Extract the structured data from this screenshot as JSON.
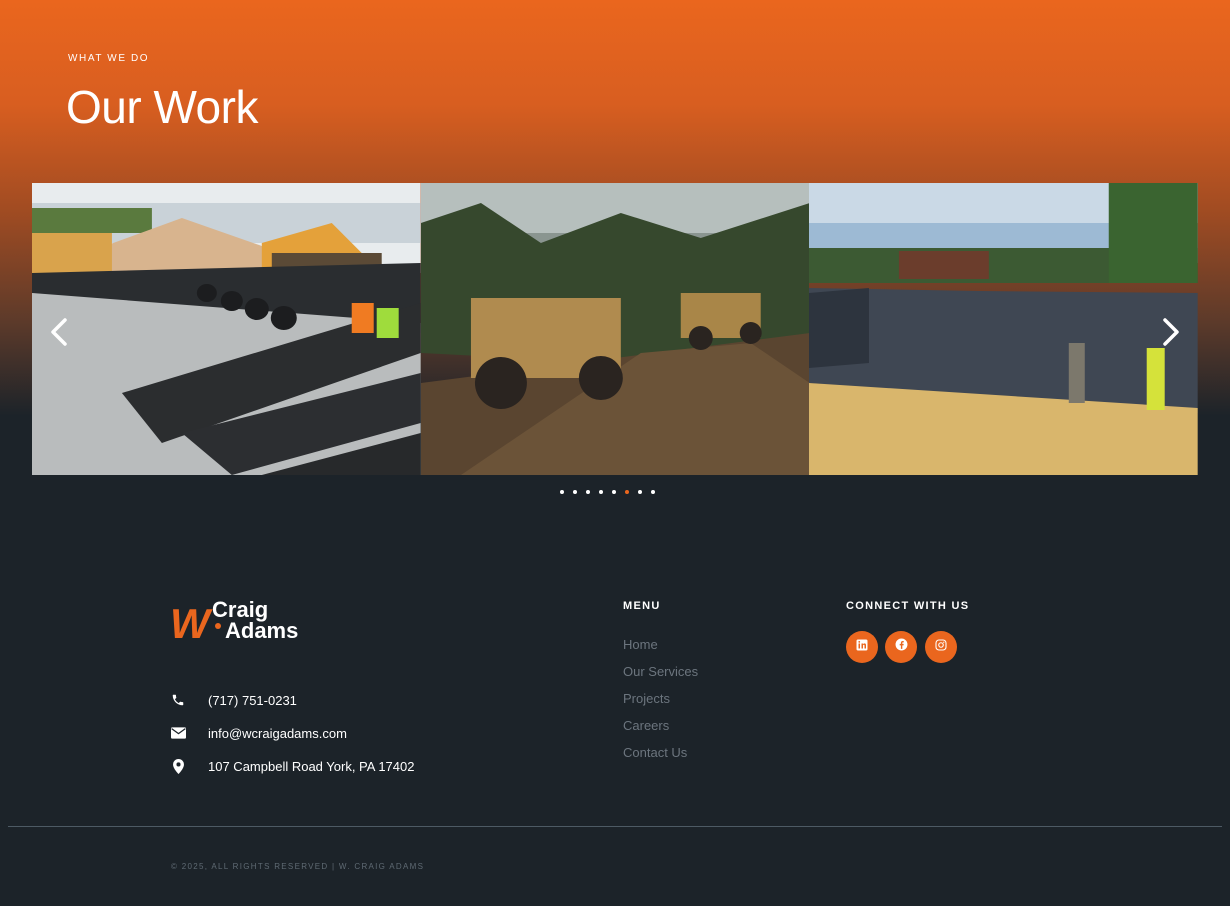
{
  "hero": {
    "eyebrow": "WHAT WE DO",
    "title": "Our Work"
  },
  "carousel": {
    "slides": [
      {
        "name": "pipe-installation-photo",
        "subject": "stormwater pipes in gravel with excavators"
      },
      {
        "name": "earthmovers-photo",
        "subject": "scrapers moving dirt on trail"
      },
      {
        "name": "pond-liner-photo",
        "subject": "workers inspecting basin liner"
      }
    ],
    "prev_icon": "chevron-left-icon",
    "next_icon": "chevron-right-icon",
    "dot_count": 8,
    "active_dot": 5
  },
  "footer": {
    "logo": {
      "line1": "Craig",
      "line2": "Adams",
      "mark": "W"
    },
    "contacts": [
      {
        "icon": "phone-icon",
        "text": "(717) 751-0231"
      },
      {
        "icon": "envelope-icon",
        "text": "info@wcraigadams.com"
      },
      {
        "icon": "map-pin-icon",
        "text": "107 Campbell Road York, PA 17402"
      }
    ],
    "menu_title": "MENU",
    "menu": [
      {
        "label": "Home"
      },
      {
        "label": "Our Services"
      },
      {
        "label": "Projects"
      },
      {
        "label": "Careers"
      },
      {
        "label": "Contact Us"
      }
    ],
    "connect_title": "CONNECT WITH US",
    "social": [
      {
        "icon": "linkedin-icon"
      },
      {
        "icon": "facebook-icon"
      },
      {
        "icon": "instagram-icon"
      }
    ],
    "copyright": "© 2025, ALL RIGHTS RESERVED | W. CRAIG ADAMS"
  },
  "colors": {
    "accent": "#ea661e",
    "background": "#1c2329",
    "muted_link": "#6c757e"
  }
}
